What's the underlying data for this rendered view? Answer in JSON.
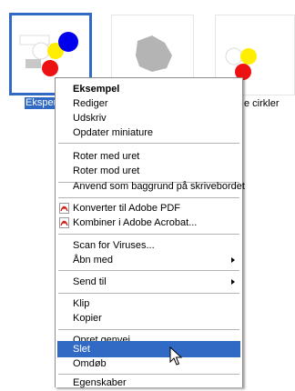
{
  "thumbnails": [
    {
      "name": "thumbnail-eksempel",
      "label": "Eksperiment",
      "selected": true
    },
    {
      "name": "thumbnail-blob",
      "label": "",
      "selected": false
    },
    {
      "name": "thumbnail-cirkler",
      "label": "e cirkler",
      "selected": false
    }
  ],
  "menu": {
    "items": [
      {
        "label": "Eksempel",
        "bold": true
      },
      {
        "label": "Rediger"
      },
      {
        "label": "Udskriv"
      },
      {
        "label": "Opdater miniature"
      },
      {
        "label": "Roter med uret"
      },
      {
        "label": "Roter mod uret"
      },
      {
        "label": "Anvend som baggrund på skrivebordet"
      },
      {
        "label": "Konverter til Adobe PDF",
        "icon": "pdf-icon"
      },
      {
        "label": "Kombiner i Adobe Acrobat...",
        "icon": "pdf-icon"
      },
      {
        "label": "Scan for Viruses..."
      },
      {
        "label": "Åbn med",
        "submenu": true
      },
      {
        "label": "Send til",
        "submenu": true
      },
      {
        "label": "Klip"
      },
      {
        "label": "Kopier"
      },
      {
        "label": "Opret genvej"
      },
      {
        "label": "Slet",
        "highlighted": true
      },
      {
        "label": "Omdøb"
      },
      {
        "label": "Egenskaber"
      }
    ]
  },
  "colors": {
    "selection": "#316ac5",
    "red": "#ee1111",
    "yellow": "#ffee00",
    "blue": "#0000ee",
    "blob": "#b4b4b4"
  }
}
